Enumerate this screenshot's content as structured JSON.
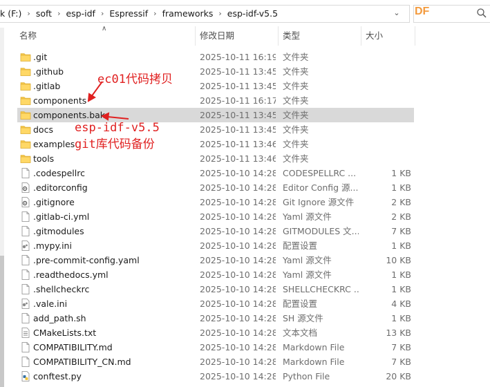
{
  "address": {
    "crumbs": [
      "k (F:)",
      "soft",
      "esp-idf",
      "Espressif",
      "frameworks",
      "esp-idf-v5.5"
    ],
    "search_overlay": "DF"
  },
  "columns": {
    "name": "名称",
    "date": "修改日期",
    "type": "类型",
    "size": "大小"
  },
  "rows": [
    {
      "name": ".git",
      "date": "2025-10-11 16:19",
      "type": "文件夹",
      "size": "",
      "icon": "folder"
    },
    {
      "name": ".github",
      "date": "2025-10-11 13:45",
      "type": "文件夹",
      "size": "",
      "icon": "folder"
    },
    {
      "name": ".gitlab",
      "date": "2025-10-11 13:45",
      "type": "文件夹",
      "size": "",
      "icon": "folder"
    },
    {
      "name": "components",
      "date": "2025-10-11 16:17",
      "type": "文件夹",
      "size": "",
      "icon": "folder"
    },
    {
      "name": "components.bak",
      "date": "2025-10-11 13:45",
      "type": "文件夹",
      "size": "",
      "icon": "folder",
      "selected": true
    },
    {
      "name": "docs",
      "date": "2025-10-11 13:45",
      "type": "文件夹",
      "size": "",
      "icon": "folder"
    },
    {
      "name": "examples",
      "date": "2025-10-11 13:46",
      "type": "文件夹",
      "size": "",
      "icon": "folder"
    },
    {
      "name": "tools",
      "date": "2025-10-11 13:46",
      "type": "文件夹",
      "size": "",
      "icon": "folder"
    },
    {
      "name": ".codespellrc",
      "date": "2025-10-10 14:28",
      "type": "CODESPELLRC ...",
      "size": "1 KB",
      "icon": "file"
    },
    {
      "name": ".editorconfig",
      "date": "2025-10-10 14:28",
      "type": "Editor Config 源...",
      "size": "1 KB",
      "icon": "config"
    },
    {
      "name": ".gitignore",
      "date": "2025-10-10 14:28",
      "type": "Git Ignore 源文件",
      "size": "2 KB",
      "icon": "config"
    },
    {
      "name": ".gitlab-ci.yml",
      "date": "2025-10-10 14:28",
      "type": "Yaml 源文件",
      "size": "2 KB",
      "icon": "file"
    },
    {
      "name": ".gitmodules",
      "date": "2025-10-10 14:28",
      "type": "GITMODULES 文...",
      "size": "7 KB",
      "icon": "file"
    },
    {
      "name": ".mypy.ini",
      "date": "2025-10-10 14:28",
      "type": "配置设置",
      "size": "1 KB",
      "icon": "ini"
    },
    {
      "name": ".pre-commit-config.yaml",
      "date": "2025-10-10 14:28",
      "type": "Yaml 源文件",
      "size": "10 KB",
      "icon": "file"
    },
    {
      "name": ".readthedocs.yml",
      "date": "2025-10-10 14:28",
      "type": "Yaml 源文件",
      "size": "1 KB",
      "icon": "file"
    },
    {
      "name": ".shellcheckrc",
      "date": "2025-10-10 14:28",
      "type": "SHELLCHECKRC ...",
      "size": "1 KB",
      "icon": "file"
    },
    {
      "name": ".vale.ini",
      "date": "2025-10-10 14:28",
      "type": "配置设置",
      "size": "4 KB",
      "icon": "ini"
    },
    {
      "name": "add_path.sh",
      "date": "2025-10-10 14:28",
      "type": "SH 源文件",
      "size": "1 KB",
      "icon": "file"
    },
    {
      "name": "CMakeLists.txt",
      "date": "2025-10-10 14:28",
      "type": "文本文档",
      "size": "13 KB",
      "icon": "text"
    },
    {
      "name": "COMPATIBILITY.md",
      "date": "2025-10-10 14:28",
      "type": "Markdown File",
      "size": "7 KB",
      "icon": "file"
    },
    {
      "name": "COMPATIBILITY_CN.md",
      "date": "2025-10-10 14:28",
      "type": "Markdown File",
      "size": "7 KB",
      "icon": "file"
    },
    {
      "name": "conftest.py",
      "date": "2025-10-10 14:28",
      "type": "Python File",
      "size": "20 KB",
      "icon": "python"
    }
  ],
  "annotations": {
    "copy_note": "ec01代码拷贝",
    "bak_note_line1": "esp-idf-v5.5",
    "bak_note_line2": "git库代码备份"
  },
  "colors": {
    "annotation": "#e02020",
    "folder": "#f5c74a",
    "selection": "#d9d9d9",
    "search_overlay": "#f39a3d"
  }
}
